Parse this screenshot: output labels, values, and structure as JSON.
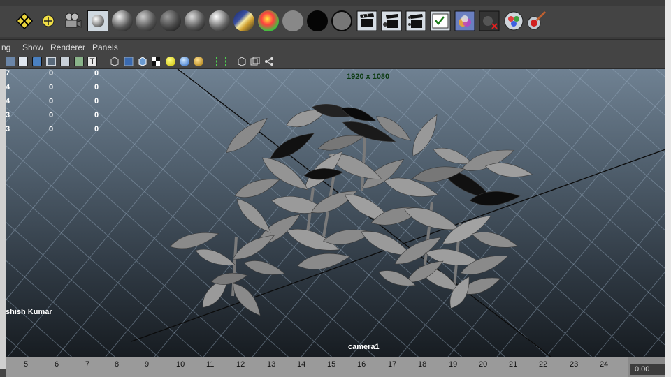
{
  "shelf": {
    "buttons": [
      {
        "icon": "hotkey-editor-icon"
      },
      {
        "icon": "light-icon"
      },
      {
        "icon": "camera-icon"
      },
      {
        "icon": "hypershade-sphere-icon"
      },
      {
        "icon": "blinn-sphere-icon"
      },
      {
        "icon": "lambert-sphere-icon"
      },
      {
        "icon": "phong-sphere-icon"
      },
      {
        "icon": "anisotropic-sphere-icon"
      },
      {
        "icon": "phongE-sphere-icon"
      },
      {
        "icon": "ramp-shader-icon"
      },
      {
        "icon": "mental-ray-shader-icon"
      },
      {
        "icon": "gray-shader-icon"
      },
      {
        "icon": "black-shader-icon"
      },
      {
        "icon": "surface-shader-icon"
      },
      {
        "icon": "render-clapboard-icon"
      },
      {
        "icon": "batch-render-clapboard-icon"
      },
      {
        "icon": "ipr-render-clapboard-icon"
      },
      {
        "icon": "render-settings-icon"
      },
      {
        "icon": "render-layers-icon"
      },
      {
        "icon": "remove-shader-icon"
      },
      {
        "icon": "shader-library-icon"
      },
      {
        "icon": "paint-brush-icon"
      }
    ]
  },
  "menu": {
    "items": [
      "ng",
      "Show",
      "Renderer",
      "Panels"
    ]
  },
  "toolbar": {
    "icons": [
      "select-camera-icon",
      "camera-attributes-icon",
      "bookmarks-icon",
      "image-plane-icon",
      "grid-icon",
      "film-gate-icon",
      "resolution-gate-icon",
      "gate-mask-icon",
      "field-chart-icon",
      "safe-action-icon",
      "safe-title-icon",
      "wireframe-icon",
      "smooth-shade-icon",
      "wireframe-on-shaded-icon",
      "textured-icon",
      "use-lights-icon",
      "shadows-icon",
      "xray-icon",
      "isolate-select-icon",
      "default-camera-icon",
      "two-view-icon",
      "hypergraph-icon"
    ]
  },
  "viewport": {
    "resolution_label": "1920 x 1080",
    "camera_label": "camera1",
    "watermark": "shish Kumar",
    "hud_rows": [
      {
        "a": "7",
        "b": "0",
        "c": "0"
      },
      {
        "a": "4",
        "b": "0",
        "c": "0"
      },
      {
        "a": "4",
        "b": "0",
        "c": "0"
      },
      {
        "a": "3",
        "b": "0",
        "c": "0"
      },
      {
        "a": "3",
        "b": "0",
        "c": "0"
      }
    ]
  },
  "timeline": {
    "frames": [
      "5",
      "6",
      "7",
      "8",
      "9",
      "10",
      "11",
      "12",
      "13",
      "14",
      "15",
      "16",
      "17",
      "18",
      "19",
      "20",
      "21",
      "22",
      "23",
      "24"
    ],
    "current_time": "0.00"
  }
}
